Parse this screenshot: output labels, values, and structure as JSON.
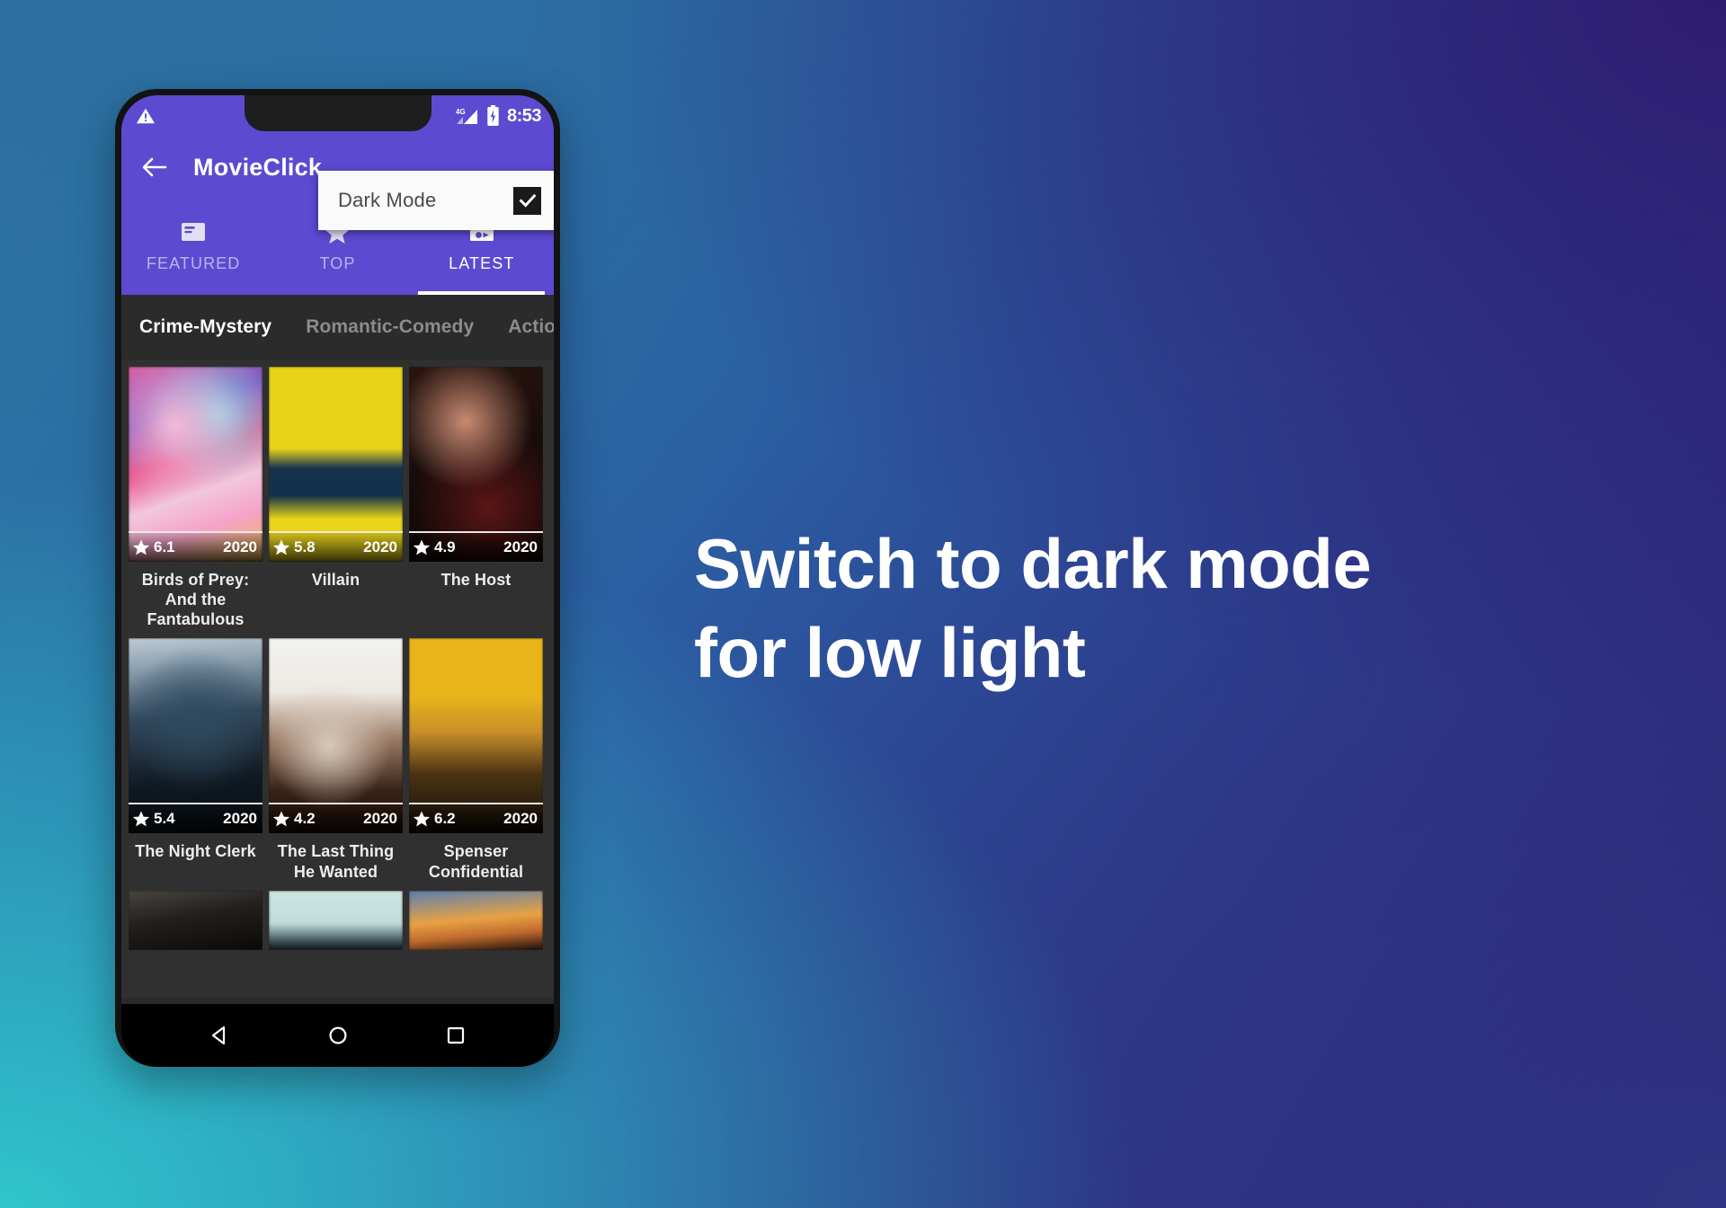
{
  "background": {
    "gradient_colors": [
      "#2C6FA0",
      "#2FC0CA",
      "#2E3483",
      "#2E1C72"
    ]
  },
  "headline": {
    "line1": "Switch to dark mode",
    "line2": "for low light"
  },
  "phone": {
    "status_bar": {
      "warning_icon": "warning-triangle-icon",
      "network_label": "4G",
      "signal_icon": "signal-bars-icon",
      "battery_icon": "battery-icon",
      "time": "8:53"
    },
    "app_bar": {
      "back_icon": "back-arrow-icon",
      "title": "MovieClick",
      "accent_color": "#5C4AD1"
    },
    "popup_menu": {
      "item_label": "Dark Mode",
      "checkbox_icon": "checkmark-icon",
      "checked": true
    },
    "main_tabs": [
      {
        "label": "FEATURED",
        "icon": "article-icon",
        "active": false
      },
      {
        "label": "TOP",
        "icon": "star-icon",
        "active": false
      },
      {
        "label": "LATEST",
        "icon": "movie-clapper-icon",
        "active": true
      }
    ],
    "genre_tabs": [
      {
        "label": "Crime-Mystery",
        "active": true
      },
      {
        "label": "Romantic-Comedy",
        "active": false
      },
      {
        "label": "Action-",
        "active": false
      }
    ],
    "movies": {
      "row1": [
        {
          "title": "Birds of Prey: And the Fantabulous",
          "rating": "6.1",
          "year": "2020",
          "art": "art-birds"
        },
        {
          "title": "Villain",
          "rating": "5.8",
          "year": "2020",
          "art": "art-villain"
        },
        {
          "title": "The Host",
          "rating": "4.9",
          "year": "2020",
          "art": "art-host"
        }
      ],
      "row2": [
        {
          "title": "The Night Clerk",
          "rating": "5.4",
          "year": "2020",
          "art": "art-night"
        },
        {
          "title": "The Last Thing He Wanted",
          "rating": "4.2",
          "year": "2020",
          "art": "art-last"
        },
        {
          "title": "Spenser Confidential",
          "rating": "6.2",
          "year": "2020",
          "art": "art-spenser"
        }
      ],
      "row3": [
        {
          "title": "",
          "rating": "",
          "year": "",
          "art": "art-p1"
        },
        {
          "title": "",
          "rating": "",
          "year": "",
          "art": "art-p2"
        },
        {
          "title": "",
          "rating": "",
          "year": "",
          "art": "art-p3"
        }
      ]
    },
    "nav_bar": [
      {
        "icon": "back-triangle-icon"
      },
      {
        "icon": "home-circle-icon"
      },
      {
        "icon": "recents-square-icon"
      }
    ]
  }
}
